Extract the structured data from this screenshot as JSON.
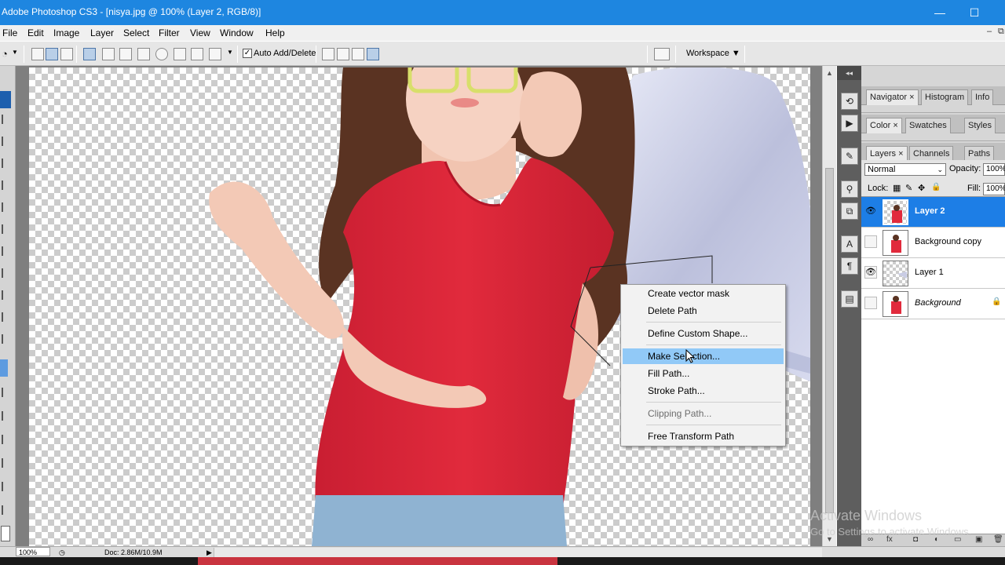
{
  "window": {
    "title": "Adobe Photoshop CS3 - [nisya.jpg @ 100% (Layer 2, RGB/8)]",
    "minimize_glyph": "—",
    "maximize_glyph": "☐"
  },
  "menu": {
    "items": [
      "File",
      "Edit",
      "Image",
      "Layer",
      "Select",
      "Filter",
      "View",
      "Window",
      "Help"
    ],
    "doc_minimize": "–",
    "doc_restore": "⧉"
  },
  "options_bar": {
    "auto_add_delete_label": "Auto Add/Delete",
    "auto_add_delete_checked": "✓",
    "workspace_label": "Workspace ▼"
  },
  "panels": {
    "group1_tabs": [
      "Navigator",
      "Histogram",
      "Info"
    ],
    "group2_tabs": [
      "Color",
      "Swatches",
      "Styles"
    ],
    "group3_tabs": [
      "Channels",
      "Paths"
    ],
    "layers_tab": "Layers",
    "close_glyph": "×",
    "blend_mode": "Normal",
    "opacity_label": "Opacity:",
    "opacity_value": "100%",
    "lock_label": "Lock:",
    "fill_label": "Fill:",
    "fill_value": "100%",
    "collapse_glyph": "◂◂"
  },
  "layers": [
    {
      "name": "Layer 2",
      "visible": "👁",
      "active": true
    },
    {
      "name": "Background copy",
      "visible": "",
      "active": false
    },
    {
      "name": "Layer 1",
      "visible": "👁",
      "active": false
    },
    {
      "name": "Background",
      "visible": "",
      "active": false,
      "locked": "🔒"
    }
  ],
  "layer_footer_icons": [
    "∞",
    "fx",
    "◘",
    "◐",
    "▭",
    "▣",
    "🗑"
  ],
  "context_menu": {
    "items": [
      {
        "label": "Create vector mask",
        "state": "normal"
      },
      {
        "label": "Delete Path",
        "state": "normal"
      },
      {
        "label": "Define Custom Shape...",
        "state": "normal"
      },
      {
        "label": "Make Selection...",
        "state": "highlighted"
      },
      {
        "label": "Fill Path...",
        "state": "normal"
      },
      {
        "label": "Stroke Path...",
        "state": "normal"
      },
      {
        "label": "Clipping Path...",
        "state": "disabled"
      },
      {
        "label": "Free Transform Path",
        "state": "normal"
      }
    ]
  },
  "status_bar": {
    "zoom": "100%",
    "doc_info": "Doc: 2.86M/10.9M",
    "arrow": "▶"
  },
  "watermark": {
    "line1": "Activate Windows",
    "line2": "Go to Settings to activate Windows."
  },
  "colors": {
    "titlebar": "#1e86e0",
    "active_layer": "#1d7ee6",
    "menu_highlight": "#91c9f7",
    "shirt": "#e12a3c"
  }
}
